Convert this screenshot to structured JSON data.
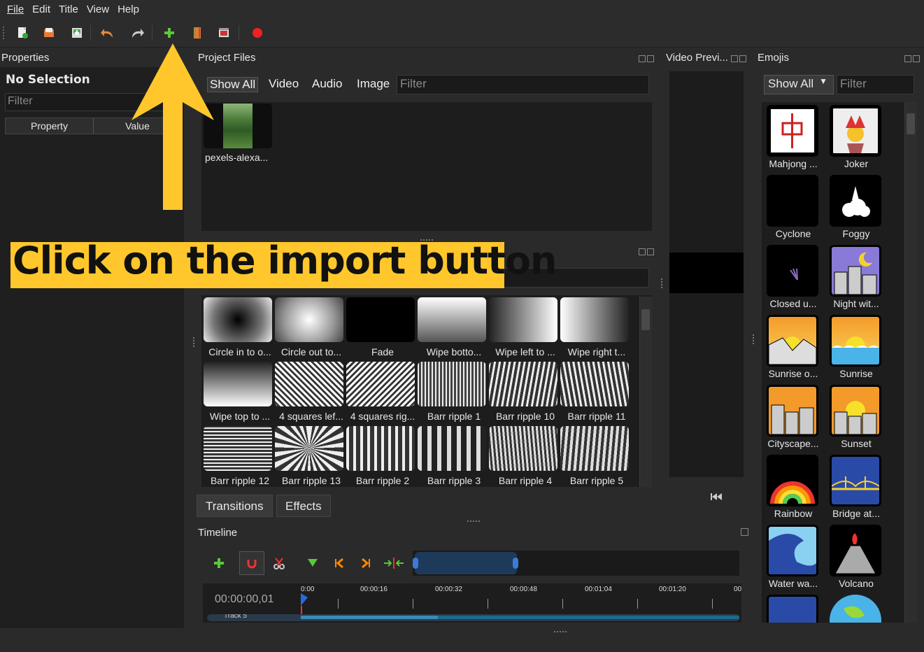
{
  "menu": {
    "file": "File",
    "edit": "Edit",
    "title": "Title",
    "view": "View",
    "help": "Help"
  },
  "properties": {
    "title": "Properties",
    "no_selection": "No Selection",
    "filter_placeholder": "Filter",
    "col_property": "Property",
    "col_value": "Value"
  },
  "project_files": {
    "title": "Project Files",
    "tabs": [
      "Show All",
      "Video",
      "Audio",
      "Image"
    ],
    "filter_placeholder": "Filter",
    "files": [
      {
        "name": "pexels-alexa..."
      }
    ]
  },
  "transitions": {
    "items": [
      "Circle in to o...",
      "Circle out to...",
      "Fade",
      "Wipe botto...",
      "Wipe left to ...",
      "Wipe right t...",
      "Wipe top to ...",
      "4 squares lef...",
      "4 squares rig...",
      "Barr ripple 1",
      "Barr ripple 10",
      "Barr ripple 11",
      "Barr ripple 12",
      "Barr ripple 13",
      "Barr ripple 2",
      "Barr ripple 3",
      "Barr ripple 4",
      "Barr ripple 5"
    ]
  },
  "bottom_tabs": {
    "transitions": "Transitions",
    "effects": "Effects"
  },
  "video_preview": {
    "title": "Video Previ..."
  },
  "emojis": {
    "title": "Emojis",
    "dropdown": "Show All",
    "filter_placeholder": "Filter",
    "items": [
      "Mahjong ...",
      "Joker",
      "Cyclone",
      "Foggy",
      "Closed u...",
      "Night wit...",
      "Sunrise o...",
      "Sunrise",
      "Cityscape...",
      "Sunset",
      "Rainbow",
      "Bridge at...",
      "Water wa...",
      "Volcano"
    ]
  },
  "timeline": {
    "title": "Timeline",
    "current_time": "00:00:00,01",
    "ticks": [
      "0:00",
      "00:00:16",
      "00:00:32",
      "00:00:48",
      "00:01:04",
      "00:01:20",
      "00"
    ],
    "track_label": "Track 5"
  },
  "annotation": {
    "text": "Click on the import button"
  },
  "colors": {
    "callout": "#ffc72c",
    "arrow": "#ffc72c"
  }
}
